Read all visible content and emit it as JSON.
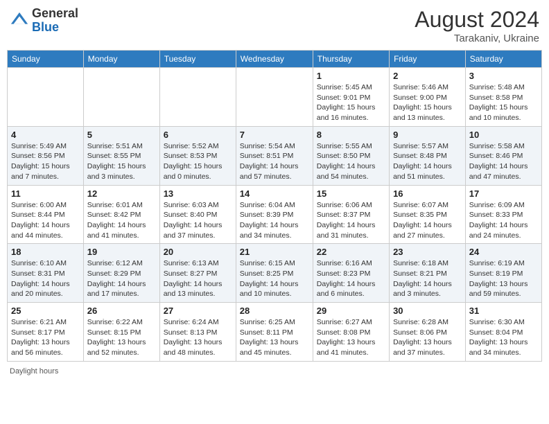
{
  "header": {
    "logo_general": "General",
    "logo_blue": "Blue",
    "month_year": "August 2024",
    "location": "Tarakaniv, Ukraine"
  },
  "footer": {
    "label": "Daylight hours"
  },
  "columns": [
    "Sunday",
    "Monday",
    "Tuesday",
    "Wednesday",
    "Thursday",
    "Friday",
    "Saturday"
  ],
  "weeks": [
    [
      {
        "day": "",
        "sunrise": "",
        "sunset": "",
        "daylight": ""
      },
      {
        "day": "",
        "sunrise": "",
        "sunset": "",
        "daylight": ""
      },
      {
        "day": "",
        "sunrise": "",
        "sunset": "",
        "daylight": ""
      },
      {
        "day": "",
        "sunrise": "",
        "sunset": "",
        "daylight": ""
      },
      {
        "day": "1",
        "sunrise": "Sunrise: 5:45 AM",
        "sunset": "Sunset: 9:01 PM",
        "daylight": "Daylight: 15 hours and 16 minutes."
      },
      {
        "day": "2",
        "sunrise": "Sunrise: 5:46 AM",
        "sunset": "Sunset: 9:00 PM",
        "daylight": "Daylight: 15 hours and 13 minutes."
      },
      {
        "day": "3",
        "sunrise": "Sunrise: 5:48 AM",
        "sunset": "Sunset: 8:58 PM",
        "daylight": "Daylight: 15 hours and 10 minutes."
      }
    ],
    [
      {
        "day": "4",
        "sunrise": "Sunrise: 5:49 AM",
        "sunset": "Sunset: 8:56 PM",
        "daylight": "Daylight: 15 hours and 7 minutes."
      },
      {
        "day": "5",
        "sunrise": "Sunrise: 5:51 AM",
        "sunset": "Sunset: 8:55 PM",
        "daylight": "Daylight: 15 hours and 3 minutes."
      },
      {
        "day": "6",
        "sunrise": "Sunrise: 5:52 AM",
        "sunset": "Sunset: 8:53 PM",
        "daylight": "Daylight: 15 hours and 0 minutes."
      },
      {
        "day": "7",
        "sunrise": "Sunrise: 5:54 AM",
        "sunset": "Sunset: 8:51 PM",
        "daylight": "Daylight: 14 hours and 57 minutes."
      },
      {
        "day": "8",
        "sunrise": "Sunrise: 5:55 AM",
        "sunset": "Sunset: 8:50 PM",
        "daylight": "Daylight: 14 hours and 54 minutes."
      },
      {
        "day": "9",
        "sunrise": "Sunrise: 5:57 AM",
        "sunset": "Sunset: 8:48 PM",
        "daylight": "Daylight: 14 hours and 51 minutes."
      },
      {
        "day": "10",
        "sunrise": "Sunrise: 5:58 AM",
        "sunset": "Sunset: 8:46 PM",
        "daylight": "Daylight: 14 hours and 47 minutes."
      }
    ],
    [
      {
        "day": "11",
        "sunrise": "Sunrise: 6:00 AM",
        "sunset": "Sunset: 8:44 PM",
        "daylight": "Daylight: 14 hours and 44 minutes."
      },
      {
        "day": "12",
        "sunrise": "Sunrise: 6:01 AM",
        "sunset": "Sunset: 8:42 PM",
        "daylight": "Daylight: 14 hours and 41 minutes."
      },
      {
        "day": "13",
        "sunrise": "Sunrise: 6:03 AM",
        "sunset": "Sunset: 8:40 PM",
        "daylight": "Daylight: 14 hours and 37 minutes."
      },
      {
        "day": "14",
        "sunrise": "Sunrise: 6:04 AM",
        "sunset": "Sunset: 8:39 PM",
        "daylight": "Daylight: 14 hours and 34 minutes."
      },
      {
        "day": "15",
        "sunrise": "Sunrise: 6:06 AM",
        "sunset": "Sunset: 8:37 PM",
        "daylight": "Daylight: 14 hours and 31 minutes."
      },
      {
        "day": "16",
        "sunrise": "Sunrise: 6:07 AM",
        "sunset": "Sunset: 8:35 PM",
        "daylight": "Daylight: 14 hours and 27 minutes."
      },
      {
        "day": "17",
        "sunrise": "Sunrise: 6:09 AM",
        "sunset": "Sunset: 8:33 PM",
        "daylight": "Daylight: 14 hours and 24 minutes."
      }
    ],
    [
      {
        "day": "18",
        "sunrise": "Sunrise: 6:10 AM",
        "sunset": "Sunset: 8:31 PM",
        "daylight": "Daylight: 14 hours and 20 minutes."
      },
      {
        "day": "19",
        "sunrise": "Sunrise: 6:12 AM",
        "sunset": "Sunset: 8:29 PM",
        "daylight": "Daylight: 14 hours and 17 minutes."
      },
      {
        "day": "20",
        "sunrise": "Sunrise: 6:13 AM",
        "sunset": "Sunset: 8:27 PM",
        "daylight": "Daylight: 14 hours and 13 minutes."
      },
      {
        "day": "21",
        "sunrise": "Sunrise: 6:15 AM",
        "sunset": "Sunset: 8:25 PM",
        "daylight": "Daylight: 14 hours and 10 minutes."
      },
      {
        "day": "22",
        "sunrise": "Sunrise: 6:16 AM",
        "sunset": "Sunset: 8:23 PM",
        "daylight": "Daylight: 14 hours and 6 minutes."
      },
      {
        "day": "23",
        "sunrise": "Sunrise: 6:18 AM",
        "sunset": "Sunset: 8:21 PM",
        "daylight": "Daylight: 14 hours and 3 minutes."
      },
      {
        "day": "24",
        "sunrise": "Sunrise: 6:19 AM",
        "sunset": "Sunset: 8:19 PM",
        "daylight": "Daylight: 13 hours and 59 minutes."
      }
    ],
    [
      {
        "day": "25",
        "sunrise": "Sunrise: 6:21 AM",
        "sunset": "Sunset: 8:17 PM",
        "daylight": "Daylight: 13 hours and 56 minutes."
      },
      {
        "day": "26",
        "sunrise": "Sunrise: 6:22 AM",
        "sunset": "Sunset: 8:15 PM",
        "daylight": "Daylight: 13 hours and 52 minutes."
      },
      {
        "day": "27",
        "sunrise": "Sunrise: 6:24 AM",
        "sunset": "Sunset: 8:13 PM",
        "daylight": "Daylight: 13 hours and 48 minutes."
      },
      {
        "day": "28",
        "sunrise": "Sunrise: 6:25 AM",
        "sunset": "Sunset: 8:11 PM",
        "daylight": "Daylight: 13 hours and 45 minutes."
      },
      {
        "day": "29",
        "sunrise": "Sunrise: 6:27 AM",
        "sunset": "Sunset: 8:08 PM",
        "daylight": "Daylight: 13 hours and 41 minutes."
      },
      {
        "day": "30",
        "sunrise": "Sunrise: 6:28 AM",
        "sunset": "Sunset: 8:06 PM",
        "daylight": "Daylight: 13 hours and 37 minutes."
      },
      {
        "day": "31",
        "sunrise": "Sunrise: 6:30 AM",
        "sunset": "Sunset: 8:04 PM",
        "daylight": "Daylight: 13 hours and 34 minutes."
      }
    ]
  ]
}
